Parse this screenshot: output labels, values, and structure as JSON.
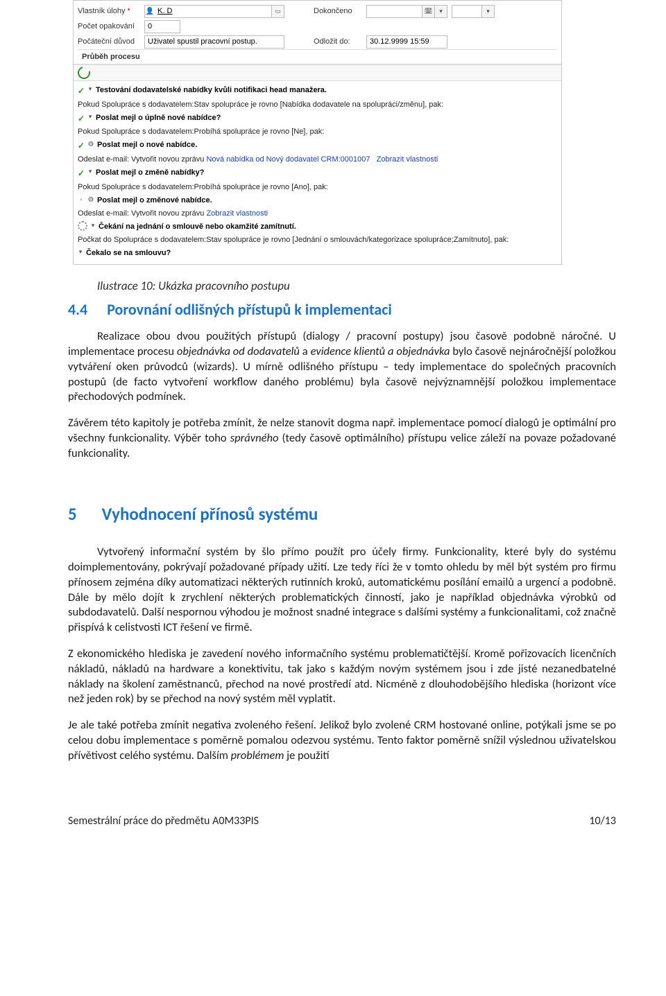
{
  "form": {
    "owner_label": "Vlastník úlohy",
    "owner_required": "*",
    "owner_value": "K. D",
    "repeat_label": "Počet opakování",
    "repeat_value": "0",
    "reason_label": "Počáteční důvod",
    "reason_value": "Uživatel spustil pracovní postup.",
    "completed_label": "Dokončeno",
    "completed_value": "",
    "postpone_label": "Odložit do:",
    "postpone_value": "30.12.9999 15:59",
    "progress_label": "Průběh procesu"
  },
  "tree": {
    "n1": "Testování dodavatelské nabídky kvůli notifikaci head manažera.",
    "n1_1": "Pokud Spolupráce s dodavatelem:Stav spolupráce je rovno [Nabídka dodavatele na spolupráci/změnu], pak:",
    "n1_1_1": "Poslat mejl o úplně nové nabídce?",
    "n1_1_1_a": "Pokud Spolupráce s dodavatelem:Probíhá spolupráce je rovno [Ne], pak:",
    "n1_1_1_a_i": "Poslat mejl o nové nabídce.",
    "n1_1_1_a_ii_pre": "Odeslat e-mail: Vytvořit novou zprávu ",
    "n1_1_1_a_ii_link1": "Nová nabídka od Nový dodavatel CRM:0001007",
    "n1_1_1_a_ii_link2": "Zobrazit vlastnosti",
    "n1_1_2": "Poslat mejl o změně nabídky?",
    "n1_1_2_a": "Pokud Spolupráce s dodavatelem:Probíhá spolupráce je rovno [Ano], pak:",
    "n1_1_2_a_i": "Poslat mejl o změnové nabídce.",
    "n1_1_2_a_ii_pre": "Odeslat e-mail: Vytvořit novou zprávu  ",
    "n1_1_2_a_ii_link": "Zobrazit vlastnosti",
    "n2": "Čekání na jednání o smlouvě nebo okamžité zamítnutí.",
    "n2_1": "Počkat do Spolupráce s dodavatelem:Stav spolupráce je rovno [Jednání o smlouvách/kategorizace spolupráce;Zamítnuto], pak:",
    "n2_1_1": "Čekalo se na smlouvu?"
  },
  "caption": "Ilustrace 10: Ukázka pracovního postupu",
  "h2": {
    "num": "4.4",
    "text": "Porovnání odlišných přístupů k implementaci"
  },
  "p1_a": "Realizace obou dvou použitých přístupů (dialogy / pracovní postupy) jsou časově podobně náročné. U implementace procesu ",
  "p1_i1": "objednávka od dodavatelů",
  "p1_b": " a ",
  "p1_i2": "evidence klientů a objednávka",
  "p1_c": " bylo časově nejnáročnější položkou vytváření oken průvodců (wizards). U mírně odlišného přístupu – tedy implementace do společných pracovních postupů (de facto vytvoření workflow daného problému) byla časově nejvýznamnější položkou implementace přechodových podmínek.",
  "p2_a": "Závěrem této kapitoly je potřeba zmínit, že nelze stanovit dogma např. implementace pomocí dialogů je optimální pro všechny funkcionality. Výběr toho ",
  "p2_i1": "správného",
  "p2_b": " (tedy časově optimálního) přístupu velice záleží na povaze požadované funkcionality.",
  "h1": {
    "num": "5",
    "text": "Vyhodnocení přínosů systému"
  },
  "p3": "Vytvořený informační systém by šlo přímo použít pro účely firmy. Funkcionality, které byly do systému doimplementovány, pokrývají požadované případy užití. Lze tedy říci že v tomto ohledu by měl být systém pro firmu přínosem zejména díky automatizaci některých rutinních kroků, automatickému posílání emailů a urgencí a podobně. Dále by mělo dojít k zrychlení některých problematických činností, jako je například objednávka výrobků od subdodavatelů. Další nespornou výhodou je možnost snadné integrace s dalšími systémy a funkcionalitami, což značně přispívá k celistvosti ICT řešení ve firmě.",
  "p4": "Z ekonomického hlediska je zavedení nového informačního systému problematičtější. Kromě pořizovacích licenčních nákladů, nákladů na hardware a konektivitu, tak jako s každým novým systémem jsou i zde jisté nezanedbatelné náklady na školení zaměstnanců, přechod na nové prostředí atd. Nicméně z dlouhodobějšího hlediska (horizont více než jeden rok) by se přechod na nový systém měl vyplatit.",
  "p5_a": "Je ale také potřeba zmínit negativa zvoleného řešení. Jelikož bylo zvolené CRM hostované online, potýkali jsme se po celou dobu implementace s poměrně pomalou odezvou systému. Tento faktor poměrně snížil výslednou uživatelskou přívětivost celého systému. Dalším ",
  "p5_i1": "problémem",
  "p5_b": "  je použití",
  "footer": {
    "left": "Semestrální práce do předmětu A0M33PIS",
    "right": "10/13"
  }
}
